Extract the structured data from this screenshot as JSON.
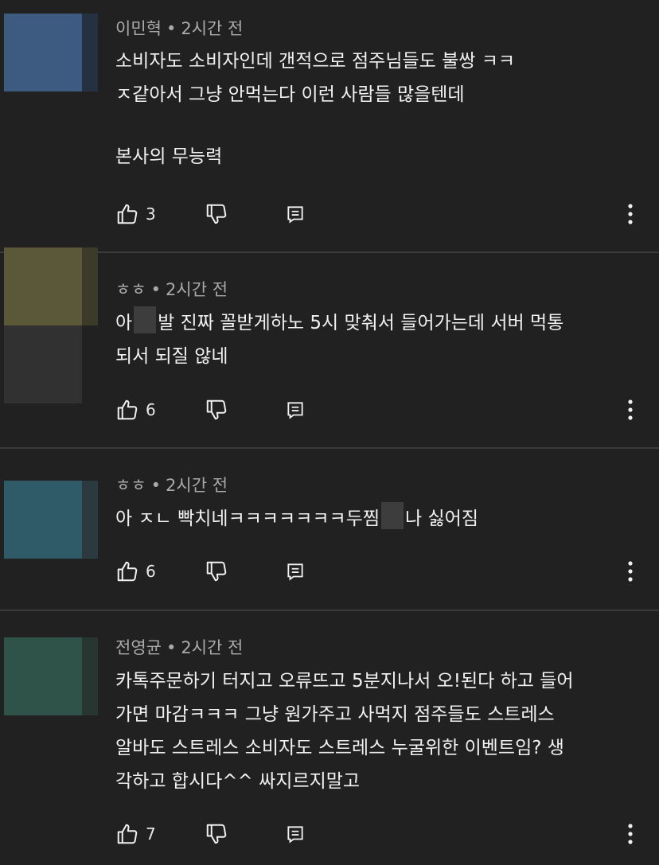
{
  "comments": [
    {
      "author": "이민혁",
      "time": "2시간 전",
      "lines": [
        "소비자도 소비자인데 갠적으로 점주님들도 불쌍 ㅋㅋ",
        "ㅈ같아서 그냥 안먹는다 이런 사람들 많을텐데",
        "",
        "본사의 무능력"
      ],
      "likes": "3",
      "avatar_colors": [
        "#3d5a80",
        "#233142"
      ]
    },
    {
      "author": "ㅎㅎ",
      "time": "2시간 전",
      "line1_a": "아",
      "line1_b": "발 진짜 꼴받게하노 5시 맞춰서 들어가는데 서버 먹통",
      "line2": "되서 되질 않네",
      "likes": "6",
      "avatar_colors": [
        "#5a5838",
        "#313131",
        "#262727"
      ]
    },
    {
      "author": "ㅎㅎ",
      "time": "2시간 전",
      "line1_a": "아 ㅈㄴ 빡치네ㅋㅋㅋㅋㅋㅋㅋ두찜",
      "line1_b": "나 싫어짐",
      "likes": "6",
      "avatar_colors": [
        "#2f5a68",
        "#2a3a3f"
      ]
    },
    {
      "author": "전영균",
      "time": "2시간 전",
      "lines": [
        "카톡주문하기 터지고 오류뜨고 5분지나서 오!된다 하고 들어",
        "가면 마감ㅋㅋㅋ 그냥 원가주고 사먹지 점주들도 스트레스",
        "알바도 스트레스 소비자도 스트레스 누굴위한 이벤트임? 생",
        "각하고 합시다^^ 싸지르지말고"
      ],
      "likes": "7",
      "avatar_colors": [
        "#2f5348",
        "#283631"
      ]
    }
  ],
  "separator": "•",
  "icons": {
    "like": "thumbs-up-icon",
    "dislike": "thumbs-down-icon",
    "reply": "reply-comment-icon",
    "more": "more-vertical-icon"
  }
}
